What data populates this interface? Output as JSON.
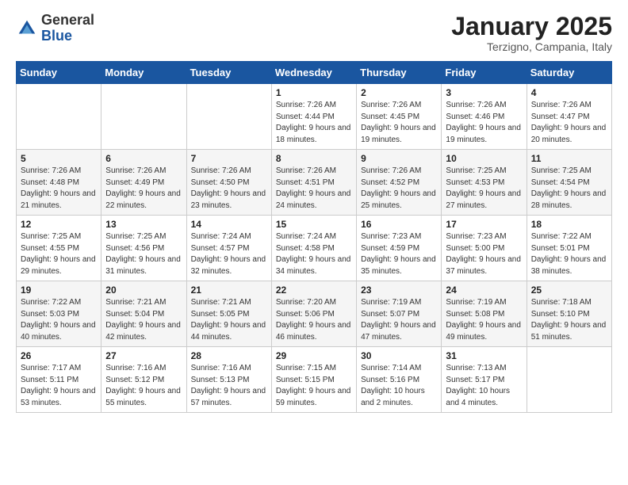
{
  "logo": {
    "general": "General",
    "blue": "Blue"
  },
  "header": {
    "month": "January 2025",
    "location": "Terzigno, Campania, Italy"
  },
  "weekdays": [
    "Sunday",
    "Monday",
    "Tuesday",
    "Wednesday",
    "Thursday",
    "Friday",
    "Saturday"
  ],
  "weeks": [
    [
      {
        "day": "",
        "sunrise": "",
        "sunset": "",
        "daylight": ""
      },
      {
        "day": "",
        "sunrise": "",
        "sunset": "",
        "daylight": ""
      },
      {
        "day": "",
        "sunrise": "",
        "sunset": "",
        "daylight": ""
      },
      {
        "day": "1",
        "sunrise": "Sunrise: 7:26 AM",
        "sunset": "Sunset: 4:44 PM",
        "daylight": "Daylight: 9 hours and 18 minutes."
      },
      {
        "day": "2",
        "sunrise": "Sunrise: 7:26 AM",
        "sunset": "Sunset: 4:45 PM",
        "daylight": "Daylight: 9 hours and 19 minutes."
      },
      {
        "day": "3",
        "sunrise": "Sunrise: 7:26 AM",
        "sunset": "Sunset: 4:46 PM",
        "daylight": "Daylight: 9 hours and 19 minutes."
      },
      {
        "day": "4",
        "sunrise": "Sunrise: 7:26 AM",
        "sunset": "Sunset: 4:47 PM",
        "daylight": "Daylight: 9 hours and 20 minutes."
      }
    ],
    [
      {
        "day": "5",
        "sunrise": "Sunrise: 7:26 AM",
        "sunset": "Sunset: 4:48 PM",
        "daylight": "Daylight: 9 hours and 21 minutes."
      },
      {
        "day": "6",
        "sunrise": "Sunrise: 7:26 AM",
        "sunset": "Sunset: 4:49 PM",
        "daylight": "Daylight: 9 hours and 22 minutes."
      },
      {
        "day": "7",
        "sunrise": "Sunrise: 7:26 AM",
        "sunset": "Sunset: 4:50 PM",
        "daylight": "Daylight: 9 hours and 23 minutes."
      },
      {
        "day": "8",
        "sunrise": "Sunrise: 7:26 AM",
        "sunset": "Sunset: 4:51 PM",
        "daylight": "Daylight: 9 hours and 24 minutes."
      },
      {
        "day": "9",
        "sunrise": "Sunrise: 7:26 AM",
        "sunset": "Sunset: 4:52 PM",
        "daylight": "Daylight: 9 hours and 25 minutes."
      },
      {
        "day": "10",
        "sunrise": "Sunrise: 7:25 AM",
        "sunset": "Sunset: 4:53 PM",
        "daylight": "Daylight: 9 hours and 27 minutes."
      },
      {
        "day": "11",
        "sunrise": "Sunrise: 7:25 AM",
        "sunset": "Sunset: 4:54 PM",
        "daylight": "Daylight: 9 hours and 28 minutes."
      }
    ],
    [
      {
        "day": "12",
        "sunrise": "Sunrise: 7:25 AM",
        "sunset": "Sunset: 4:55 PM",
        "daylight": "Daylight: 9 hours and 29 minutes."
      },
      {
        "day": "13",
        "sunrise": "Sunrise: 7:25 AM",
        "sunset": "Sunset: 4:56 PM",
        "daylight": "Daylight: 9 hours and 31 minutes."
      },
      {
        "day": "14",
        "sunrise": "Sunrise: 7:24 AM",
        "sunset": "Sunset: 4:57 PM",
        "daylight": "Daylight: 9 hours and 32 minutes."
      },
      {
        "day": "15",
        "sunrise": "Sunrise: 7:24 AM",
        "sunset": "Sunset: 4:58 PM",
        "daylight": "Daylight: 9 hours and 34 minutes."
      },
      {
        "day": "16",
        "sunrise": "Sunrise: 7:23 AM",
        "sunset": "Sunset: 4:59 PM",
        "daylight": "Daylight: 9 hours and 35 minutes."
      },
      {
        "day": "17",
        "sunrise": "Sunrise: 7:23 AM",
        "sunset": "Sunset: 5:00 PM",
        "daylight": "Daylight: 9 hours and 37 minutes."
      },
      {
        "day": "18",
        "sunrise": "Sunrise: 7:22 AM",
        "sunset": "Sunset: 5:01 PM",
        "daylight": "Daylight: 9 hours and 38 minutes."
      }
    ],
    [
      {
        "day": "19",
        "sunrise": "Sunrise: 7:22 AM",
        "sunset": "Sunset: 5:03 PM",
        "daylight": "Daylight: 9 hours and 40 minutes."
      },
      {
        "day": "20",
        "sunrise": "Sunrise: 7:21 AM",
        "sunset": "Sunset: 5:04 PM",
        "daylight": "Daylight: 9 hours and 42 minutes."
      },
      {
        "day": "21",
        "sunrise": "Sunrise: 7:21 AM",
        "sunset": "Sunset: 5:05 PM",
        "daylight": "Daylight: 9 hours and 44 minutes."
      },
      {
        "day": "22",
        "sunrise": "Sunrise: 7:20 AM",
        "sunset": "Sunset: 5:06 PM",
        "daylight": "Daylight: 9 hours and 46 minutes."
      },
      {
        "day": "23",
        "sunrise": "Sunrise: 7:19 AM",
        "sunset": "Sunset: 5:07 PM",
        "daylight": "Daylight: 9 hours and 47 minutes."
      },
      {
        "day": "24",
        "sunrise": "Sunrise: 7:19 AM",
        "sunset": "Sunset: 5:08 PM",
        "daylight": "Daylight: 9 hours and 49 minutes."
      },
      {
        "day": "25",
        "sunrise": "Sunrise: 7:18 AM",
        "sunset": "Sunset: 5:10 PM",
        "daylight": "Daylight: 9 hours and 51 minutes."
      }
    ],
    [
      {
        "day": "26",
        "sunrise": "Sunrise: 7:17 AM",
        "sunset": "Sunset: 5:11 PM",
        "daylight": "Daylight: 9 hours and 53 minutes."
      },
      {
        "day": "27",
        "sunrise": "Sunrise: 7:16 AM",
        "sunset": "Sunset: 5:12 PM",
        "daylight": "Daylight: 9 hours and 55 minutes."
      },
      {
        "day": "28",
        "sunrise": "Sunrise: 7:16 AM",
        "sunset": "Sunset: 5:13 PM",
        "daylight": "Daylight: 9 hours and 57 minutes."
      },
      {
        "day": "29",
        "sunrise": "Sunrise: 7:15 AM",
        "sunset": "Sunset: 5:15 PM",
        "daylight": "Daylight: 9 hours and 59 minutes."
      },
      {
        "day": "30",
        "sunrise": "Sunrise: 7:14 AM",
        "sunset": "Sunset: 5:16 PM",
        "daylight": "Daylight: 10 hours and 2 minutes."
      },
      {
        "day": "31",
        "sunrise": "Sunrise: 7:13 AM",
        "sunset": "Sunset: 5:17 PM",
        "daylight": "Daylight: 10 hours and 4 minutes."
      },
      {
        "day": "",
        "sunrise": "",
        "sunset": "",
        "daylight": ""
      }
    ]
  ]
}
